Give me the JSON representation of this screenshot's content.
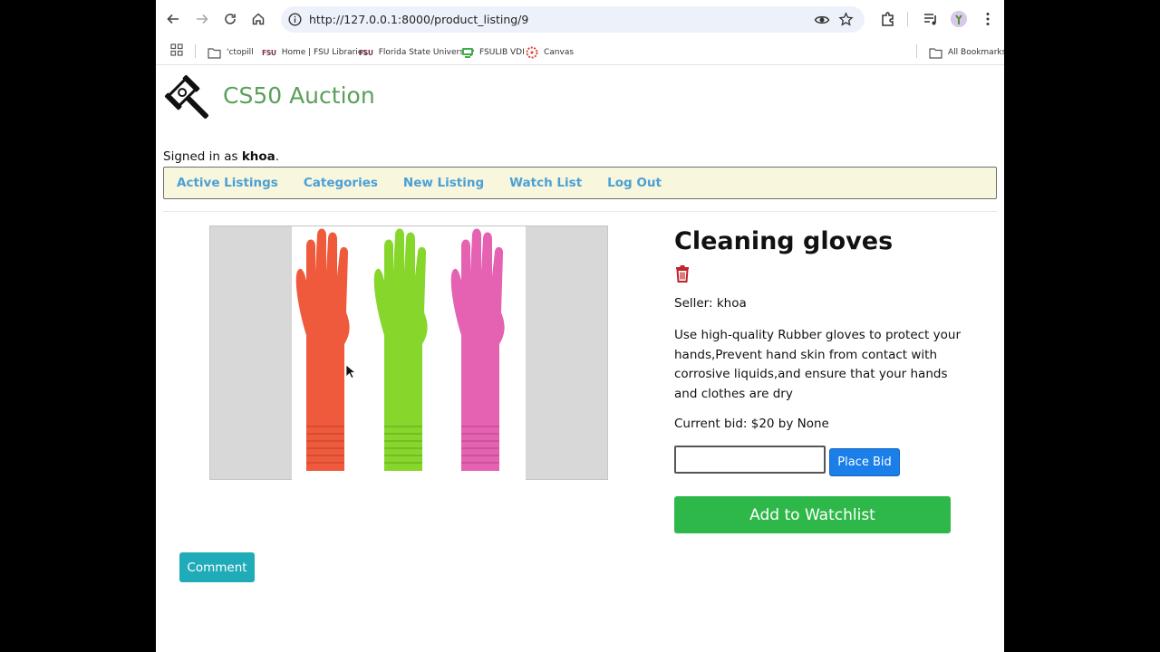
{
  "browser": {
    "url": "http://127.0.0.1:8000/product_listing/9",
    "bookmarks": [
      {
        "label": "'ctopill",
        "icon": "folder-icon"
      },
      {
        "badge": "FSU",
        "label": "Home | FSU Libraries"
      },
      {
        "badge": "FSU",
        "label": "Florida State University"
      },
      {
        "label": "FSULIB VDI",
        "icon": "vdi-icon"
      },
      {
        "label": "Canvas",
        "icon": "canvas-icon"
      }
    ],
    "all_bookmarks": "All Bookmarks"
  },
  "site": {
    "title": "CS50 Auction",
    "signed_in_prefix": "Signed in as ",
    "username": "khoa",
    "signed_in_suffix": ".",
    "nav": [
      "Active Listings",
      "Categories",
      "New Listing",
      "Watch List",
      "Log Out"
    ],
    "link_color": "#4aa0d6"
  },
  "listing": {
    "title": "Cleaning gloves",
    "seller": "Seller: khoa",
    "description": "Use high-quality Rubber gloves to protect your hands,Prevent hand skin from contact with corrosive liquids,and ensure that your hands and clothes are dry",
    "current_bid": "Current bid: $20 by None",
    "bid_input_value": "",
    "place_bid_label": "Place Bid",
    "watchlist_label": "Add to Watchlist",
    "comment_label": "Comment",
    "glove_colors": [
      "#f05a3c",
      "#86d62c",
      "#e561b1"
    ]
  }
}
